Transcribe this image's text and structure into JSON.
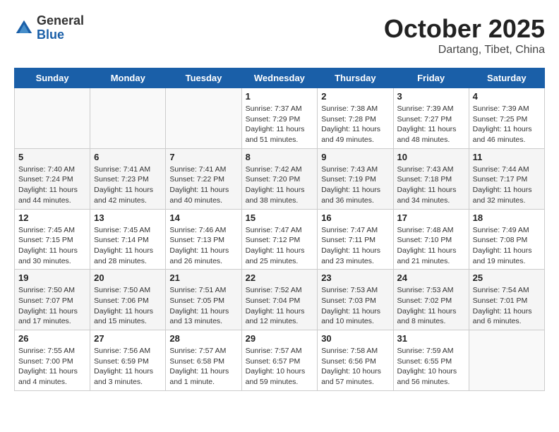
{
  "header": {
    "logo_line1": "General",
    "logo_line2": "Blue",
    "month": "October 2025",
    "location": "Dartang, Tibet, China"
  },
  "weekdays": [
    "Sunday",
    "Monday",
    "Tuesday",
    "Wednesday",
    "Thursday",
    "Friday",
    "Saturday"
  ],
  "weeks": [
    [
      {
        "day": "",
        "sunrise": "",
        "sunset": "",
        "daylight": ""
      },
      {
        "day": "",
        "sunrise": "",
        "sunset": "",
        "daylight": ""
      },
      {
        "day": "",
        "sunrise": "",
        "sunset": "",
        "daylight": ""
      },
      {
        "day": "1",
        "sunrise": "Sunrise: 7:37 AM",
        "sunset": "Sunset: 7:29 PM",
        "daylight": "Daylight: 11 hours and 51 minutes."
      },
      {
        "day": "2",
        "sunrise": "Sunrise: 7:38 AM",
        "sunset": "Sunset: 7:28 PM",
        "daylight": "Daylight: 11 hours and 49 minutes."
      },
      {
        "day": "3",
        "sunrise": "Sunrise: 7:39 AM",
        "sunset": "Sunset: 7:27 PM",
        "daylight": "Daylight: 11 hours and 48 minutes."
      },
      {
        "day": "4",
        "sunrise": "Sunrise: 7:39 AM",
        "sunset": "Sunset: 7:25 PM",
        "daylight": "Daylight: 11 hours and 46 minutes."
      }
    ],
    [
      {
        "day": "5",
        "sunrise": "Sunrise: 7:40 AM",
        "sunset": "Sunset: 7:24 PM",
        "daylight": "Daylight: 11 hours and 44 minutes."
      },
      {
        "day": "6",
        "sunrise": "Sunrise: 7:41 AM",
        "sunset": "Sunset: 7:23 PM",
        "daylight": "Daylight: 11 hours and 42 minutes."
      },
      {
        "day": "7",
        "sunrise": "Sunrise: 7:41 AM",
        "sunset": "Sunset: 7:22 PM",
        "daylight": "Daylight: 11 hours and 40 minutes."
      },
      {
        "day": "8",
        "sunrise": "Sunrise: 7:42 AM",
        "sunset": "Sunset: 7:20 PM",
        "daylight": "Daylight: 11 hours and 38 minutes."
      },
      {
        "day": "9",
        "sunrise": "Sunrise: 7:43 AM",
        "sunset": "Sunset: 7:19 PM",
        "daylight": "Daylight: 11 hours and 36 minutes."
      },
      {
        "day": "10",
        "sunrise": "Sunrise: 7:43 AM",
        "sunset": "Sunset: 7:18 PM",
        "daylight": "Daylight: 11 hours and 34 minutes."
      },
      {
        "day": "11",
        "sunrise": "Sunrise: 7:44 AM",
        "sunset": "Sunset: 7:17 PM",
        "daylight": "Daylight: 11 hours and 32 minutes."
      }
    ],
    [
      {
        "day": "12",
        "sunrise": "Sunrise: 7:45 AM",
        "sunset": "Sunset: 7:15 PM",
        "daylight": "Daylight: 11 hours and 30 minutes."
      },
      {
        "day": "13",
        "sunrise": "Sunrise: 7:45 AM",
        "sunset": "Sunset: 7:14 PM",
        "daylight": "Daylight: 11 hours and 28 minutes."
      },
      {
        "day": "14",
        "sunrise": "Sunrise: 7:46 AM",
        "sunset": "Sunset: 7:13 PM",
        "daylight": "Daylight: 11 hours and 26 minutes."
      },
      {
        "day": "15",
        "sunrise": "Sunrise: 7:47 AM",
        "sunset": "Sunset: 7:12 PM",
        "daylight": "Daylight: 11 hours and 25 minutes."
      },
      {
        "day": "16",
        "sunrise": "Sunrise: 7:47 AM",
        "sunset": "Sunset: 7:11 PM",
        "daylight": "Daylight: 11 hours and 23 minutes."
      },
      {
        "day": "17",
        "sunrise": "Sunrise: 7:48 AM",
        "sunset": "Sunset: 7:10 PM",
        "daylight": "Daylight: 11 hours and 21 minutes."
      },
      {
        "day": "18",
        "sunrise": "Sunrise: 7:49 AM",
        "sunset": "Sunset: 7:08 PM",
        "daylight": "Daylight: 11 hours and 19 minutes."
      }
    ],
    [
      {
        "day": "19",
        "sunrise": "Sunrise: 7:50 AM",
        "sunset": "Sunset: 7:07 PM",
        "daylight": "Daylight: 11 hours and 17 minutes."
      },
      {
        "day": "20",
        "sunrise": "Sunrise: 7:50 AM",
        "sunset": "Sunset: 7:06 PM",
        "daylight": "Daylight: 11 hours and 15 minutes."
      },
      {
        "day": "21",
        "sunrise": "Sunrise: 7:51 AM",
        "sunset": "Sunset: 7:05 PM",
        "daylight": "Daylight: 11 hours and 13 minutes."
      },
      {
        "day": "22",
        "sunrise": "Sunrise: 7:52 AM",
        "sunset": "Sunset: 7:04 PM",
        "daylight": "Daylight: 11 hours and 12 minutes."
      },
      {
        "day": "23",
        "sunrise": "Sunrise: 7:53 AM",
        "sunset": "Sunset: 7:03 PM",
        "daylight": "Daylight: 11 hours and 10 minutes."
      },
      {
        "day": "24",
        "sunrise": "Sunrise: 7:53 AM",
        "sunset": "Sunset: 7:02 PM",
        "daylight": "Daylight: 11 hours and 8 minutes."
      },
      {
        "day": "25",
        "sunrise": "Sunrise: 7:54 AM",
        "sunset": "Sunset: 7:01 PM",
        "daylight": "Daylight: 11 hours and 6 minutes."
      }
    ],
    [
      {
        "day": "26",
        "sunrise": "Sunrise: 7:55 AM",
        "sunset": "Sunset: 7:00 PM",
        "daylight": "Daylight: 11 hours and 4 minutes."
      },
      {
        "day": "27",
        "sunrise": "Sunrise: 7:56 AM",
        "sunset": "Sunset: 6:59 PM",
        "daylight": "Daylight: 11 hours and 3 minutes."
      },
      {
        "day": "28",
        "sunrise": "Sunrise: 7:57 AM",
        "sunset": "Sunset: 6:58 PM",
        "daylight": "Daylight: 11 hours and 1 minute."
      },
      {
        "day": "29",
        "sunrise": "Sunrise: 7:57 AM",
        "sunset": "Sunset: 6:57 PM",
        "daylight": "Daylight: 10 hours and 59 minutes."
      },
      {
        "day": "30",
        "sunrise": "Sunrise: 7:58 AM",
        "sunset": "Sunset: 6:56 PM",
        "daylight": "Daylight: 10 hours and 57 minutes."
      },
      {
        "day": "31",
        "sunrise": "Sunrise: 7:59 AM",
        "sunset": "Sunset: 6:55 PM",
        "daylight": "Daylight: 10 hours and 56 minutes."
      },
      {
        "day": "",
        "sunrise": "",
        "sunset": "",
        "daylight": ""
      }
    ]
  ]
}
